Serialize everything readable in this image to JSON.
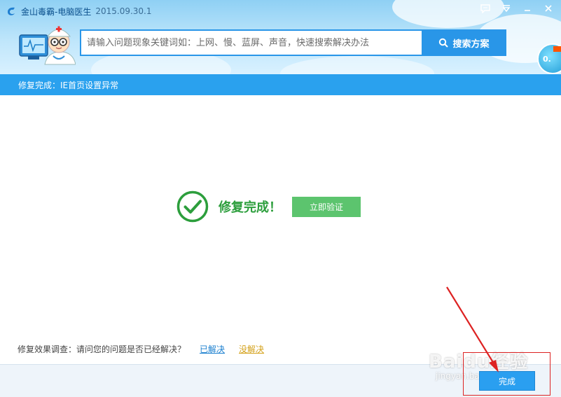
{
  "app": {
    "title": "金山毒霸-电脑医生",
    "version": "2015.09.30.1"
  },
  "search": {
    "placeholder": "请输入问题现象关键词如：上网、慢、蓝屏、声音，快速搜索解决办法",
    "button_label": "搜索方案"
  },
  "float_widget": {
    "label": "0."
  },
  "status": {
    "text": "修复完成：IE首页设置异常"
  },
  "result": {
    "message": "修复完成！",
    "verify_label": "立即验证"
  },
  "survey": {
    "question": "修复效果调查：请问您的问题是否已经解决？",
    "solved_label": "已解决",
    "unsolved_label": "没解决"
  },
  "footer": {
    "done_label": "完成"
  },
  "watermark": {
    "brand": "Baidu经验",
    "domain": "jingyan.baidu.com"
  },
  "colors": {
    "accent": "#2996e8",
    "status_bar": "#2aa1ee",
    "success": "#2c9e3c",
    "verify_button": "#5cc46e",
    "unsolved_link": "#d4a11a",
    "annotation": "#dd2222"
  }
}
